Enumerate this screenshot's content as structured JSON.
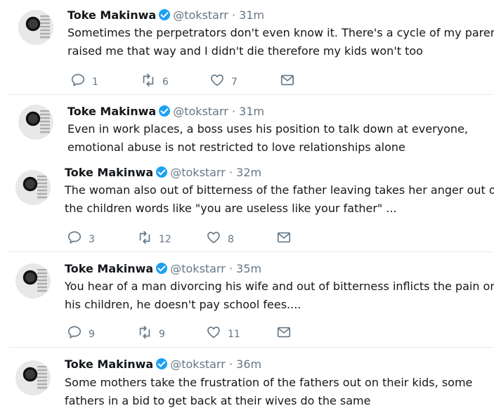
{
  "tweets": [
    {
      "name": "Toke Makinwa",
      "handle": "@tokstarr",
      "separator": "·",
      "time": "31m",
      "lines": [
        "Sometimes the perpetrators don't even know it. There's a cycle of my parents",
        "raised me that way and I didn't die therefore my kids won't too"
      ],
      "reply_count": "1",
      "retweet_count": "6",
      "like_count": "7"
    },
    {
      "name": "Toke Makinwa",
      "handle": "@tokstarr",
      "separator": "·",
      "time": "31m",
      "lines": [
        "Even in work places, a boss uses his position to talk down at everyone,",
        "emotional abuse is not restricted to love relationships alone"
      ]
    },
    {
      "name": "Toke Makinwa",
      "handle": "@tokstarr",
      "separator": "·",
      "time": "32m",
      "lines": [
        "The woman also out of bitterness of the father leaving takes her anger out on",
        "the children words like \"you are useless like your father\" ..."
      ],
      "reply_count": "3",
      "retweet_count": "12",
      "like_count": "8"
    },
    {
      "name": "Toke Makinwa",
      "handle": "@tokstarr",
      "separator": "·",
      "time": "35m",
      "lines": [
        "You hear of a man divorcing his wife and out of bitterness inflicts the pain on",
        "his children, he doesn't pay school fees...."
      ],
      "reply_count": "9",
      "retweet_count": "9",
      "like_count": "11"
    },
    {
      "name": "Toke Makinwa",
      "handle": "@tokstarr",
      "separator": "·",
      "time": "36m",
      "lines": [
        "Some mothers take the frustration of the fathers out on their kids, some",
        "fathers in a bid to get back at their wives do the same"
      ]
    }
  ],
  "colors": {
    "verified": "#1da1f2",
    "muted": "#657786",
    "divider": "#e6ecf0"
  }
}
